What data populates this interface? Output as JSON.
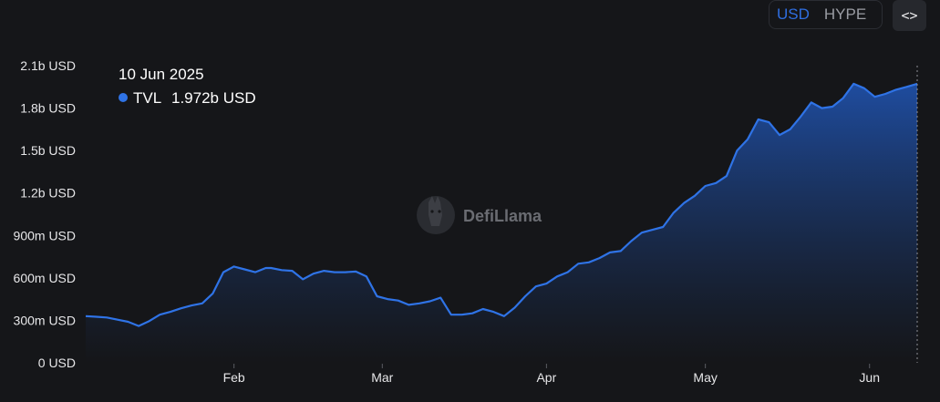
{
  "currency_toggle": {
    "options": [
      "USD",
      "HYPE"
    ],
    "selected": "USD"
  },
  "embed_button": {
    "icon": "code-embed-icon",
    "label": "<>"
  },
  "watermark": {
    "text": "DefiLlama",
    "icon": "llama-logo-icon"
  },
  "tooltip": {
    "date": "10 Jun 2025",
    "series_name": "TVL",
    "value": "1.972b USD",
    "marker_color": "#2f73e6"
  },
  "colors": {
    "line": "#2f73e6",
    "area_top": "#1f4fa6",
    "area_bottom": "#151619",
    "background": "#151619"
  },
  "chart_data": {
    "type": "area",
    "series": [
      {
        "name": "TVL",
        "unit": "USD",
        "x": [
          "2025-01-04",
          "2025-01-06",
          "2025-01-08",
          "2025-01-10",
          "2025-01-12",
          "2025-01-14",
          "2025-01-16",
          "2025-01-18",
          "2025-01-20",
          "2025-01-22",
          "2025-01-24",
          "2025-01-26",
          "2025-01-28",
          "2025-01-30",
          "2025-02-01",
          "2025-02-03",
          "2025-02-05",
          "2025-02-07",
          "2025-02-08",
          "2025-02-10",
          "2025-02-12",
          "2025-02-14",
          "2025-02-16",
          "2025-02-18",
          "2025-02-20",
          "2025-02-22",
          "2025-02-24",
          "2025-02-26",
          "2025-02-28",
          "2025-03-02",
          "2025-03-04",
          "2025-03-06",
          "2025-03-08",
          "2025-03-10",
          "2025-03-12",
          "2025-03-14",
          "2025-03-16",
          "2025-03-18",
          "2025-03-20",
          "2025-03-22",
          "2025-03-24",
          "2025-03-26",
          "2025-03-28",
          "2025-03-30",
          "2025-04-01",
          "2025-04-03",
          "2025-04-05",
          "2025-04-07",
          "2025-04-09",
          "2025-04-11",
          "2025-04-13",
          "2025-04-15",
          "2025-04-17",
          "2025-04-19",
          "2025-04-21",
          "2025-04-23",
          "2025-04-25",
          "2025-04-27",
          "2025-04-29",
          "2025-05-01",
          "2025-05-03",
          "2025-05-05",
          "2025-05-07",
          "2025-05-09",
          "2025-05-11",
          "2025-05-13",
          "2025-05-15",
          "2025-05-17",
          "2025-05-19",
          "2025-05-21",
          "2025-05-23",
          "2025-05-25",
          "2025-05-27",
          "2025-05-29",
          "2025-05-31",
          "2025-06-02",
          "2025-06-04",
          "2025-06-06",
          "2025-06-08",
          "2025-06-10"
        ],
        "values": [
          330,
          325,
          320,
          305,
          290,
          260,
          295,
          340,
          360,
          385,
          405,
          420,
          490,
          640,
          680,
          660,
          640,
          670,
          670,
          655,
          650,
          590,
          630,
          650,
          640,
          640,
          645,
          610,
          470,
          450,
          440,
          410,
          420,
          435,
          460,
          340,
          340,
          350,
          380,
          360,
          330,
          390,
          470,
          540,
          560,
          610,
          640,
          700,
          710,
          740,
          780,
          790,
          860,
          920,
          940,
          960,
          1060,
          1130,
          1180,
          1250,
          1270,
          1320,
          1500,
          1580,
          1720,
          1700,
          1610,
          1650,
          1740,
          1840,
          1800,
          1810,
          1870,
          1972,
          1940,
          1880,
          1900,
          1930,
          1950,
          1972
        ]
      }
    ],
    "y_tick_labels": [
      "0 USD",
      "300m USD",
      "600m USD",
      "900m USD",
      "1.2b USD",
      "1.5b USD",
      "1.8b USD",
      "2.1b USD"
    ],
    "x_tick_labels": [
      "Feb",
      "Mar",
      "Apr",
      "May",
      "Jun"
    ],
    "x_tick_dates": [
      "2025-02-01",
      "2025-03-01",
      "2025-04-01",
      "2025-05-01",
      "2025-06-01"
    ],
    "ylim": [
      0,
      2100
    ],
    "xlim": [
      "2025-01-04",
      "2025-06-10"
    ],
    "grid": false,
    "legend": "tooltip top-left"
  }
}
